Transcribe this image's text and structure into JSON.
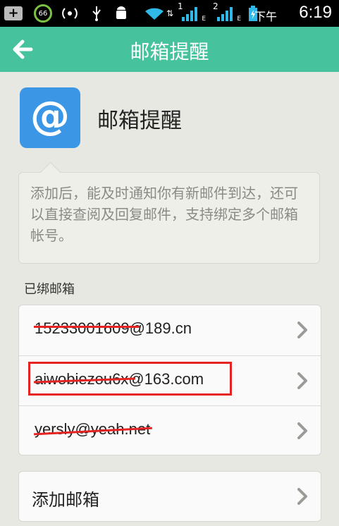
{
  "status_bar": {
    "battery_level": "66",
    "time_prefix": "下午",
    "time": "6:19",
    "sim1": "1",
    "sim2": "2",
    "net1": "E",
    "net2": "E"
  },
  "title_bar": {
    "title": "邮箱提醒"
  },
  "app": {
    "icon_glyph": "@",
    "name": "邮箱提醒"
  },
  "description": "添加后，能及时通知你有新邮件到达，还可以直接查阅及回复邮件，支持绑定多个邮箱帐号。",
  "bound_section": {
    "label": "已绑邮箱",
    "emails": [
      "15233001609@189.cn",
      "aiwobiezou6x@163.com",
      "yersly@yeah.net"
    ]
  },
  "add_email_label": "添加邮箱",
  "colors": {
    "accent": "#46c39d",
    "app_icon": "#3b97e6",
    "annotation_red": "#e52323"
  }
}
